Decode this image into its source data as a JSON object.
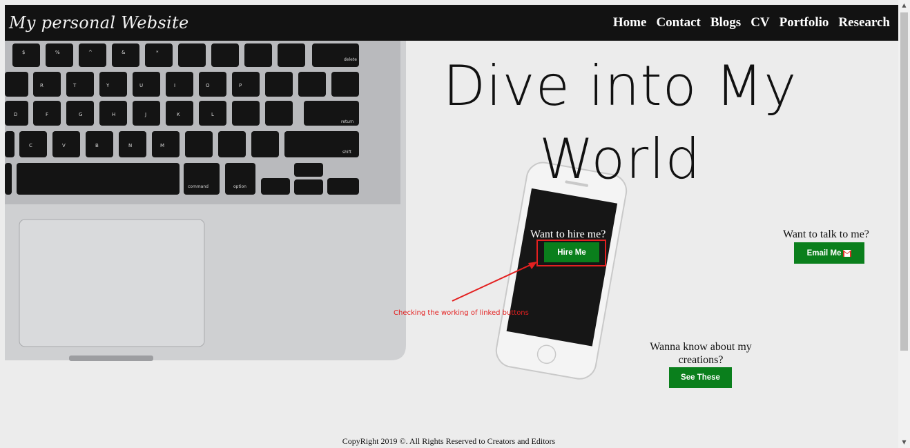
{
  "nav": {
    "brand": "My personal Website",
    "links": [
      "Home",
      "Contact",
      "Blogs",
      "CV",
      "Portfolio",
      "Research"
    ]
  },
  "hero": {
    "headline": "Dive into My World"
  },
  "hire": {
    "prompt": "Want to hire me?",
    "button": "Hire Me"
  },
  "email": {
    "prompt": "Want to talk to me?",
    "button": "Email Me",
    "icon": "gmail-icon"
  },
  "creations": {
    "prompt": "Wanna know about my creations?",
    "button": "See These"
  },
  "annotation": {
    "text": "Checking the working of linked buttons"
  },
  "footer": {
    "text": "CopyRight 2019 ©. All Rights Reserved to Creators and Editors"
  },
  "colors": {
    "button": "#0a7f1c",
    "navbar": "#121212",
    "annotation": "#e32020"
  }
}
